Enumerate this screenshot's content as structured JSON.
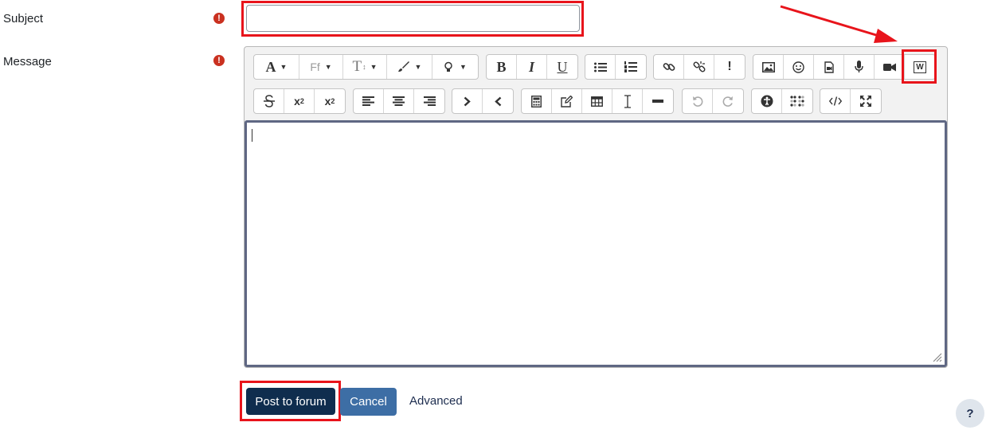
{
  "form": {
    "subject_label": "Subject",
    "message_label": "Message",
    "required_symbol": "!",
    "subject_value": ""
  },
  "toolbar": {
    "font_label": "A",
    "font_family_label": "Ff",
    "font_size_label": "T",
    "bold_label": "B",
    "italic_label": "I",
    "underline_label": "U",
    "important_label": "!",
    "subscript_base": "x",
    "subscript_mark": "2",
    "superscript_base": "x",
    "superscript_mark": "2",
    "word_icon_label": "W"
  },
  "actions": {
    "post_label": "Post to forum",
    "cancel_label": "Cancel",
    "advanced_label": "Advanced",
    "help_label": "?"
  },
  "colors": {
    "highlight": "#e8141b",
    "primary": "#0f2d4e",
    "secondary": "#3d6ea5",
    "required": "#ca3120"
  }
}
